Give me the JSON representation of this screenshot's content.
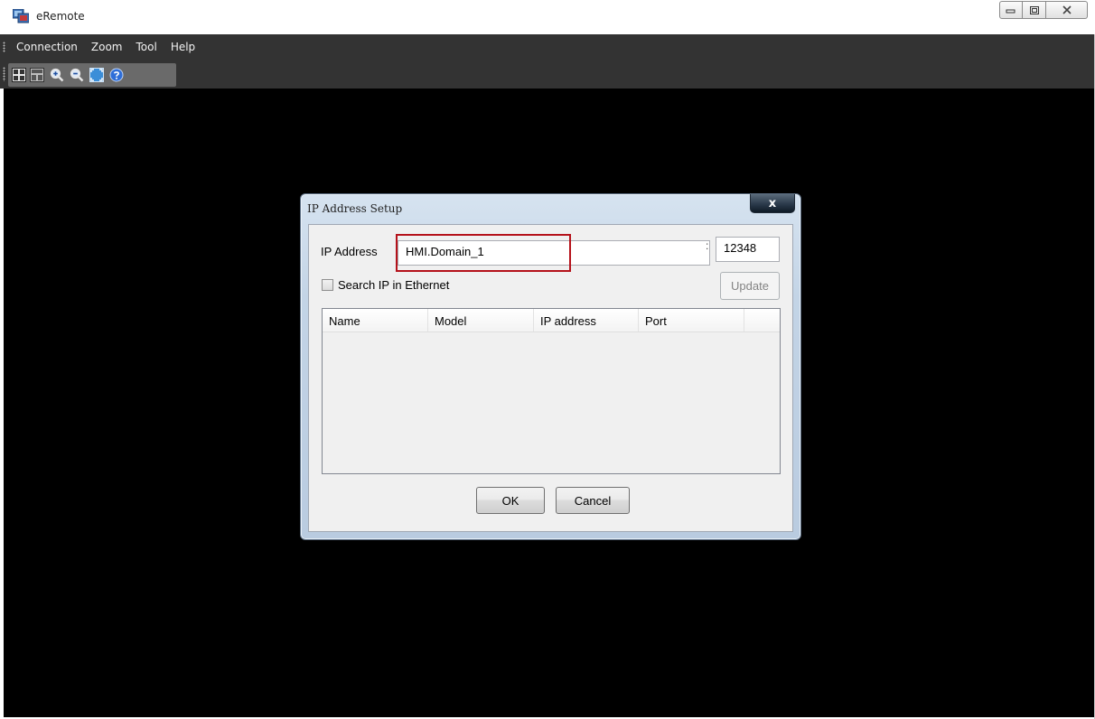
{
  "app": {
    "title": "eRemote"
  },
  "menu": {
    "items": [
      "Connection",
      "Zoom",
      "Tool",
      "Help"
    ]
  },
  "toolbar": {
    "icons": [
      "screen-layout-icon",
      "screen-layout-alt-icon",
      "zoom-in-icon",
      "zoom-out-icon",
      "fit-screen-icon",
      "help-icon"
    ]
  },
  "dialog": {
    "title": "IP Address Setup",
    "close_label": "x",
    "ip_label": "IP Address",
    "ip_value": "HMI.Domain_1",
    "port_separator": ":",
    "port_value": "12348",
    "search_label": "Search IP in Ethernet",
    "search_checked": false,
    "update_label": "Update",
    "columns": [
      "Name",
      "Model",
      "IP address",
      "Port"
    ],
    "ok_label": "OK",
    "cancel_label": "Cancel"
  },
  "colors": {
    "menubar_bg": "#333333",
    "canvas_bg": "#000000",
    "highlight": "#b5121b"
  }
}
